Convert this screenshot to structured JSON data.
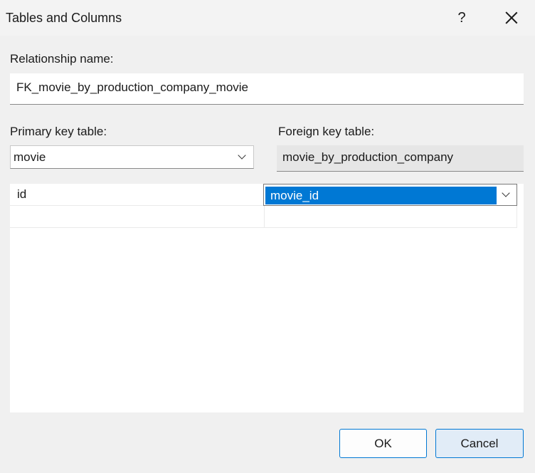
{
  "window": {
    "title": "Tables and Columns",
    "help_label": "?",
    "close_icon": "close-icon"
  },
  "relationship": {
    "label": "Relationship name:",
    "value": "FK_movie_by_production_company_movie"
  },
  "primary_key": {
    "label": "Primary key table:",
    "selected_table": "movie"
  },
  "foreign_key": {
    "label": "Foreign key table:",
    "table": "movie_by_production_company"
  },
  "columns": {
    "rows": [
      {
        "pk_column": "id",
        "fk_column": "movie_id"
      },
      {
        "pk_column": "",
        "fk_column": ""
      }
    ]
  },
  "buttons": {
    "ok": "OK",
    "cancel": "Cancel"
  },
  "colors": {
    "selection": "#0078d4",
    "background": "#f0f0f0",
    "default_button_border": "#0078d4"
  }
}
